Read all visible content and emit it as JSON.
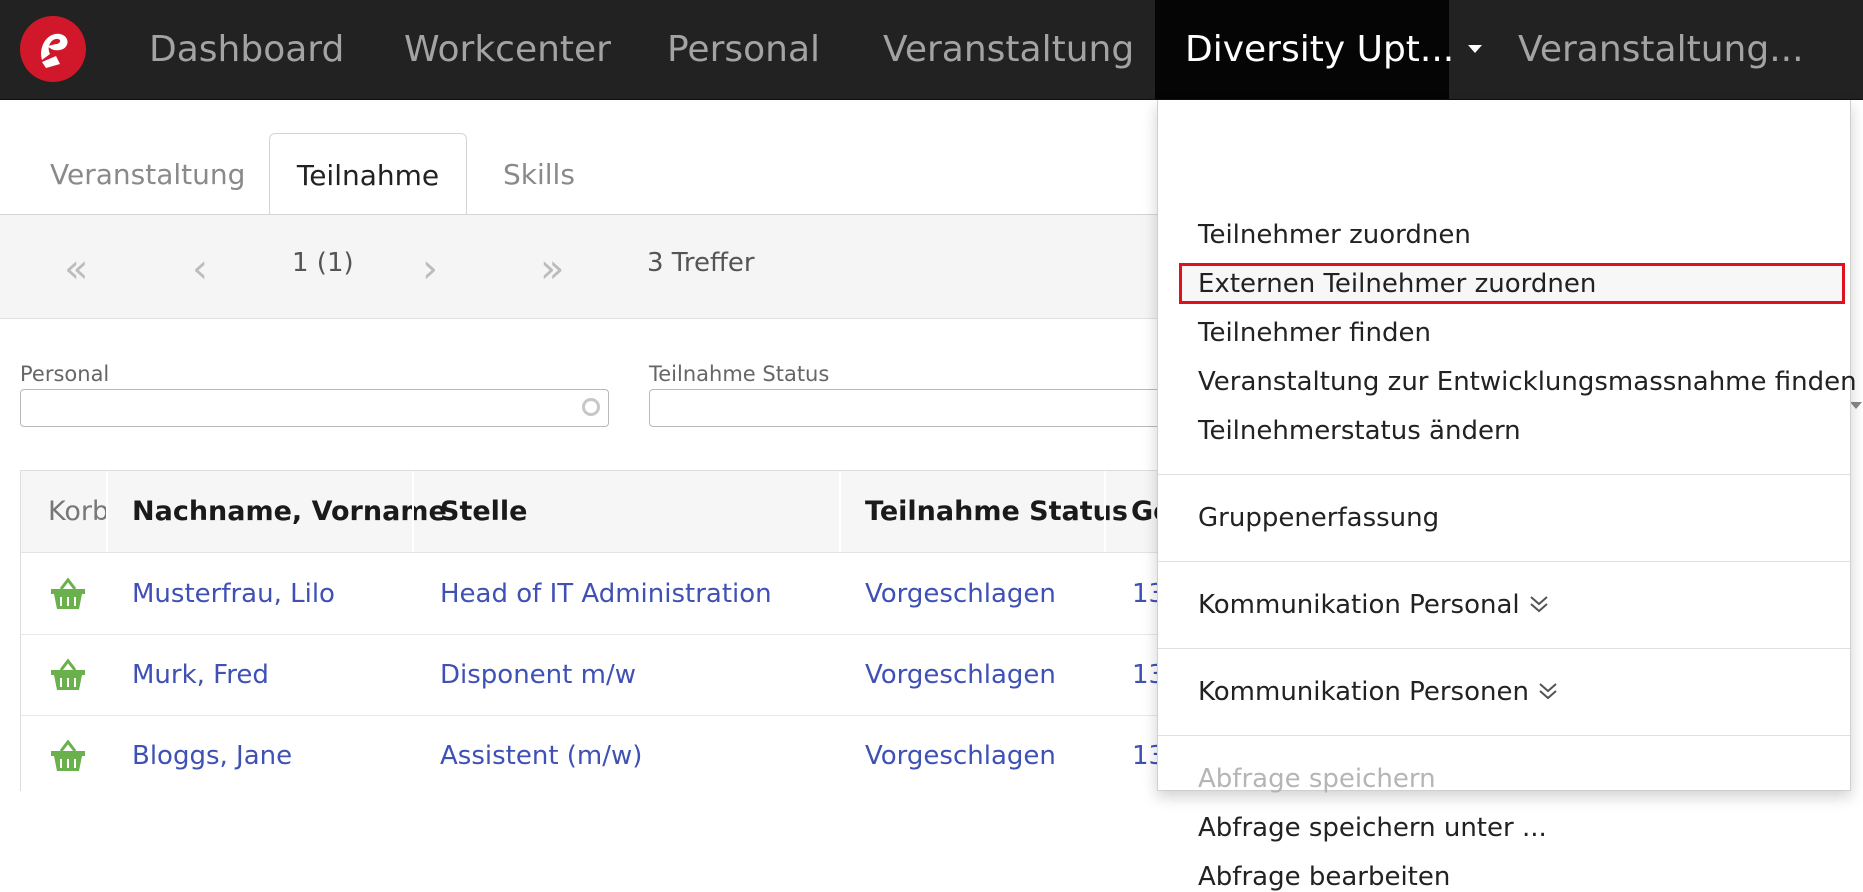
{
  "nav": {
    "items": [
      {
        "label": "Dashboard"
      },
      {
        "label": "Workcenter"
      },
      {
        "label": "Personal"
      },
      {
        "label": "Veranstaltung"
      },
      {
        "label": "Diversity Upt..."
      },
      {
        "label": "Veranstaltung..."
      }
    ],
    "active_index": 4
  },
  "tabs": [
    "Veranstaltung",
    "Teilnahme",
    "Skills"
  ],
  "pager": {
    "page": "1 (1)",
    "hits": "3 Treffer"
  },
  "filters": {
    "personal_label": "Personal",
    "status_label": "Teilnahme Status"
  },
  "table": {
    "headers": [
      "Korb",
      "Nachname, Vorname",
      "Stelle",
      "Teilnahme Status",
      "Ge"
    ],
    "rows": [
      {
        "name": "Musterfrau, Lilo",
        "stelle": "Head of IT Administration",
        "status": "Vorgeschlagen",
        "extra": "13"
      },
      {
        "name": "Murk, Fred",
        "stelle": "Disponent m/w",
        "status": "Vorgeschlagen",
        "extra": "13"
      },
      {
        "name": "Bloggs, Jane",
        "stelle": "Assistent (m/w)",
        "status": "Vorgeschlagen",
        "extra": "13"
      }
    ]
  },
  "dropdown": {
    "items": [
      "Teilnehmer zuordnen",
      "Externen Teilnehmer zuordnen",
      "Teilnehmer finden",
      "Veranstaltung zur Entwicklungsmassnahme finden",
      "Teilnehmerstatus ändern",
      "Gruppenerfassung",
      "Kommunikation Personal",
      "Kommunikation Personen",
      "Abfrage speichern",
      "Abfrage speichern unter ...",
      "Abfrage bearbeiten"
    ]
  },
  "colors": {
    "nav_bg": "#222222",
    "link": "#3f51b5",
    "basket": "#6ab04c",
    "highlight": "#e0101e",
    "logo": "#d0182a"
  }
}
